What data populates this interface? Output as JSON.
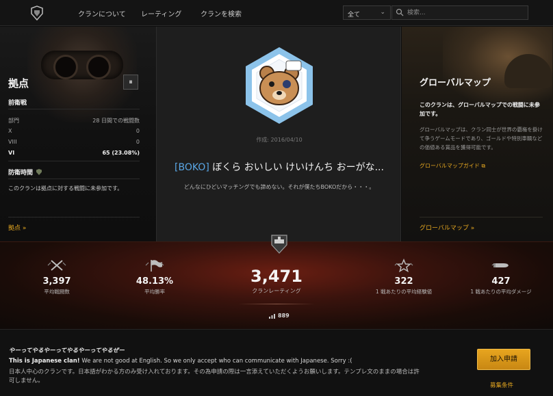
{
  "nav": {
    "links": [
      "クランについて",
      "レーティング",
      "クランを検索"
    ],
    "filter_selected": "全て",
    "search_placeholder": "検索..."
  },
  "strongholds": {
    "title": "拠点",
    "skirmish_heading": "前衛戦",
    "table_header": {
      "left": "部門",
      "right": "28 日間での戦闘数"
    },
    "rows": [
      {
        "tier": "X",
        "value": "0"
      },
      {
        "tier": "VIII",
        "value": "0"
      },
      {
        "tier": "VI",
        "value": "65 (23.08%)"
      }
    ],
    "defense_heading": "防衛時間",
    "note": "このクランは拠点に対する戦闘に未参加です。",
    "link": "拠点 »"
  },
  "clan": {
    "created": "作成: 2016/04/10",
    "tag": "[BOKO]",
    "name": " ぼくら おいしい けいけんち おーがな...",
    "motto": "どんなにひどいマッチングでも諦めない。それが僕たちBOKOだから・・・。"
  },
  "global_map": {
    "title": "グローバルマップ",
    "lead": "このクランは、グローバルマップでの戦闘に未参加です。",
    "description": "グローバルマップは、クラン同士が世界の覇権を掛けて争うゲームモードであり、ゴールドや特別車輌などの価値ある賞品を獲得可能です。",
    "guide_link": "グローバルマップガイド ⧉",
    "link": "グローバルマップ »"
  },
  "stats": {
    "avg_battles": {
      "value": "3,397",
      "label": "平均戦闘数"
    },
    "avg_winrate": {
      "value": "48.13%",
      "label": "平均勝率"
    },
    "rating": {
      "value": "3,471",
      "label": "クランレーティング"
    },
    "rank": "889",
    "avg_xp": {
      "value": "322",
      "label": "1 戦あたりの平均経験値"
    },
    "avg_damage": {
      "value": "427",
      "label": "1 戦あたりの平均ダメージ"
    }
  },
  "footer": {
    "title": "やーってやるやーってやるやーってやるぜー",
    "english_bold": "This is Japanese clan!",
    "english_rest": " We are not good at English. So we only accept who can communicate with Japanese. Sorry :(",
    "japanese": "日本人中心のクランです。日本語がわかる方のみ受け入れております。その為申請の際は一言添えていただくようお願いします。テンプレ文のままの場合は許可しません。",
    "join_button": "加入申請",
    "recruit_link": "募集条件"
  },
  "colors": {
    "accent_gold": "#e6a820",
    "tag_blue": "#5aa7e6"
  }
}
